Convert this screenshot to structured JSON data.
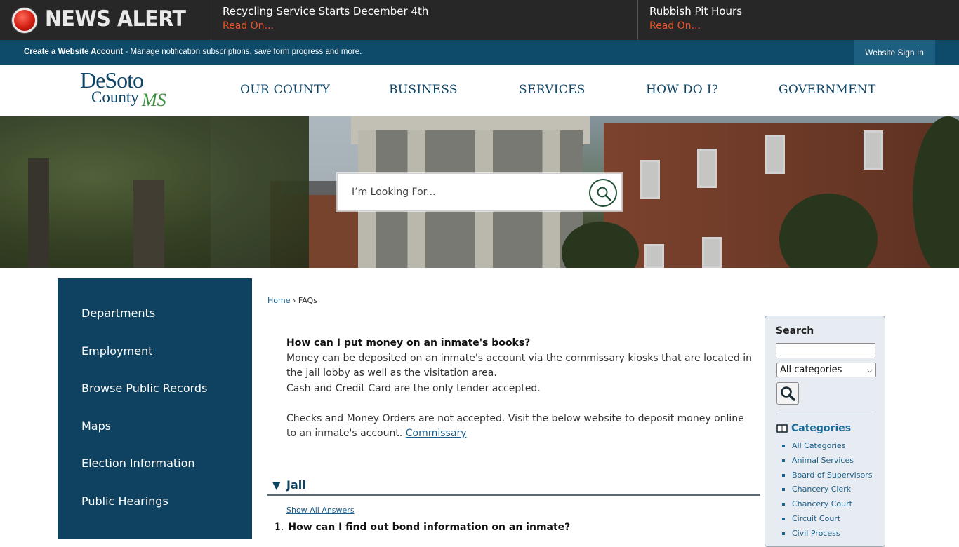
{
  "alert": {
    "label": "NEWS ALERT",
    "items": [
      {
        "headline": "Recycling Service Starts December 4th",
        "link": "Read On..."
      },
      {
        "headline": "Rubbish Pit Hours",
        "link": "Read On..."
      }
    ]
  },
  "account_bar": {
    "create_label": "Create a Website Account",
    "description": " - Manage notification subscriptions, save form progress and more.",
    "signin_label": "Website Sign In"
  },
  "logo": {
    "line1": "DeSoto",
    "line2": "County",
    "line3": "MS"
  },
  "nav": [
    "OUR COUNTY",
    "BUSINESS",
    "SERVICES",
    "HOW DO I?",
    "GOVERNMENT"
  ],
  "hero_search": {
    "placeholder": "I’m Looking For..."
  },
  "sidebar": {
    "items": [
      "Departments",
      "Employment",
      "Browse Public Records",
      "Maps",
      "Election Information",
      "Public Hearings"
    ]
  },
  "breadcrumb": {
    "home": "Home",
    "separator": "›",
    "current": "FAQs"
  },
  "faq": {
    "question": "How can I put money on an inmate's books?",
    "answer_p1": "Money can be deposited on an inmate's account via the commissary kiosks that are located in the jail lobby as well as the visitation area.",
    "answer_p2": "Cash and Credit Card are the only tender accepted.",
    "answer_p3": "Checks and Money Orders are not accepted. Visit the below website to deposit money online to an inmate's account.",
    "link_label": "Commissary"
  },
  "section": {
    "title": "Jail",
    "show_all": "Show All Answers",
    "first_q_number": "1.",
    "first_q": "How can I find out bond information on an inmate?"
  },
  "right_panel": {
    "search_label": "Search",
    "select_value": "All categories",
    "categories_title": "Categories",
    "categories": [
      "All Categories",
      "Animal Services",
      "Board of Supervisors",
      "Chancery Clerk",
      "Chancery Court",
      "Circuit Court",
      "Civil Process"
    ]
  },
  "colors": {
    "alert_bg": "#272727",
    "account_bar": "#0e4a6a",
    "brand_navy": "#0f4566",
    "sidebar": "#0f4260",
    "link": "#1b5f8a",
    "alert_link": "#e8552f"
  }
}
